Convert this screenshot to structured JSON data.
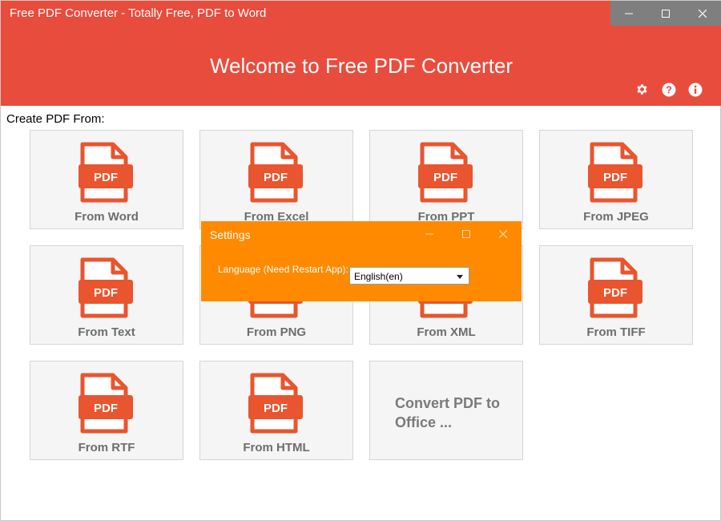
{
  "window": {
    "title": "Free PDF Converter - Totally Free, PDF to Word",
    "controls": [
      "minimize-icon",
      "maximize-icon",
      "close-icon"
    ]
  },
  "header": {
    "welcome": "Welcome to Free PDF Converter",
    "icons": [
      "gear-icon",
      "help-icon",
      "info-icon"
    ]
  },
  "section_label": "Create PDF From:",
  "pdf_icon_text": "PDF",
  "tiles": [
    {
      "label": "From Word"
    },
    {
      "label": "From Excel"
    },
    {
      "label": "From PPT"
    },
    {
      "label": "From JPEG"
    },
    {
      "label": "From Text"
    },
    {
      "label": "From PNG"
    },
    {
      "label": "From XML"
    },
    {
      "label": "From TIFF"
    },
    {
      "label": "From RTF"
    },
    {
      "label": "From HTML"
    },
    {
      "label": "Convert PDF to Office ..."
    }
  ],
  "dialog": {
    "title": "Settings",
    "language_label": "Language (Need Restart App):",
    "language_value": "English(en)"
  },
  "colors": {
    "header_bg": "#e84c3d",
    "dialog_bg": "#ff8a00",
    "icon_orange": "#e8552e",
    "tile_bg": "#f5f5f5"
  }
}
